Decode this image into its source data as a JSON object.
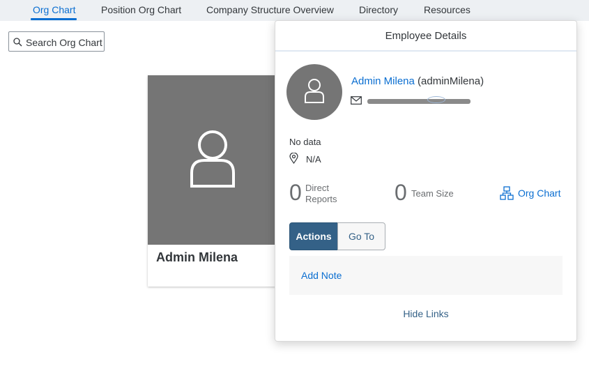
{
  "nav": {
    "tabs": [
      {
        "label": "Org Chart",
        "active": true
      },
      {
        "label": "Position Org Chart"
      },
      {
        "label": "Company Structure Overview"
      },
      {
        "label": "Directory"
      },
      {
        "label": "Resources"
      }
    ]
  },
  "search": {
    "placeholder": "Search Org Chart"
  },
  "card": {
    "name": "Admin Milena"
  },
  "details": {
    "title": "Employee Details",
    "name": "Admin Milena",
    "user_id": "(adminMilena)",
    "no_data": "No data",
    "location": "N/A",
    "stats": [
      {
        "value": "0",
        "label": "Direct Reports"
      },
      {
        "value": "0",
        "label": "Team Size"
      }
    ],
    "org_chart_link": "Org Chart",
    "actions_label": "Actions",
    "goto_label": "Go To",
    "add_note": "Add Note",
    "hide_links": "Hide Links"
  },
  "colors": {
    "accent": "#0a6ed1",
    "button": "#346187",
    "avatar": "#757575",
    "nav_bg": "#edf0f3"
  }
}
